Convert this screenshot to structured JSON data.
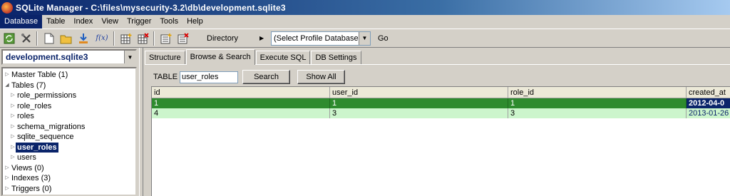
{
  "window": {
    "title": "SQLite Manager - C:\\files\\mysecurity-3.2\\db\\development.sqlite3"
  },
  "menu": [
    "Database",
    "Table",
    "Index",
    "View",
    "Trigger",
    "Tools",
    "Help"
  ],
  "toolbar": {
    "icons": [
      "reconnect-icon",
      "settings-icon",
      "new-database-icon",
      "open-database-icon",
      "import-icon",
      "function-icon",
      "create-table-icon",
      "drop-table-icon",
      "create-index-icon",
      "drop-index-icon"
    ],
    "function_label": "f(x)",
    "directory_label": "Directory",
    "profile_select": "(Select Profile Database)",
    "go_label": "Go"
  },
  "database": {
    "selected": "development.sqlite3"
  },
  "tree": [
    {
      "label": "Master Table (1)",
      "level": 0,
      "twisty": "▷"
    },
    {
      "label": "Tables (7)",
      "level": 0,
      "twisty": "◢"
    },
    {
      "label": "role_permissions",
      "level": 1,
      "twisty": "▷"
    },
    {
      "label": "role_roles",
      "level": 1,
      "twisty": "▷"
    },
    {
      "label": "roles",
      "level": 1,
      "twisty": "▷"
    },
    {
      "label": "schema_migrations",
      "level": 1,
      "twisty": "▷"
    },
    {
      "label": "sqlite_sequence",
      "level": 1,
      "twisty": "▷"
    },
    {
      "label": "user_roles",
      "level": 1,
      "twisty": "▷",
      "selected": true
    },
    {
      "label": "users",
      "level": 1,
      "twisty": "▷"
    },
    {
      "label": "Views (0)",
      "level": 0,
      "twisty": "▷"
    },
    {
      "label": "Indexes (3)",
      "level": 0,
      "twisty": "▷"
    },
    {
      "label": "Triggers (0)",
      "level": 0,
      "twisty": "▷"
    }
  ],
  "tabs": [
    "Structure",
    "Browse & Search",
    "Execute SQL",
    "DB Settings"
  ],
  "active_tab": "Browse & Search",
  "browse": {
    "table_label": "TABLE",
    "table_value": "user_roles",
    "search_label": "Search",
    "show_all_label": "Show All",
    "columns": [
      "id",
      "user_id",
      "role_id",
      "created_at"
    ],
    "rows": [
      [
        "1",
        "1",
        "1",
        "2012-04-0"
      ],
      [
        "4",
        "3",
        "3",
        "2013-01-26"
      ]
    ]
  },
  "colors": {
    "selected_row": "#2e8b2e",
    "alt_row": "#ccf5cc",
    "selection": "#0a246a"
  }
}
